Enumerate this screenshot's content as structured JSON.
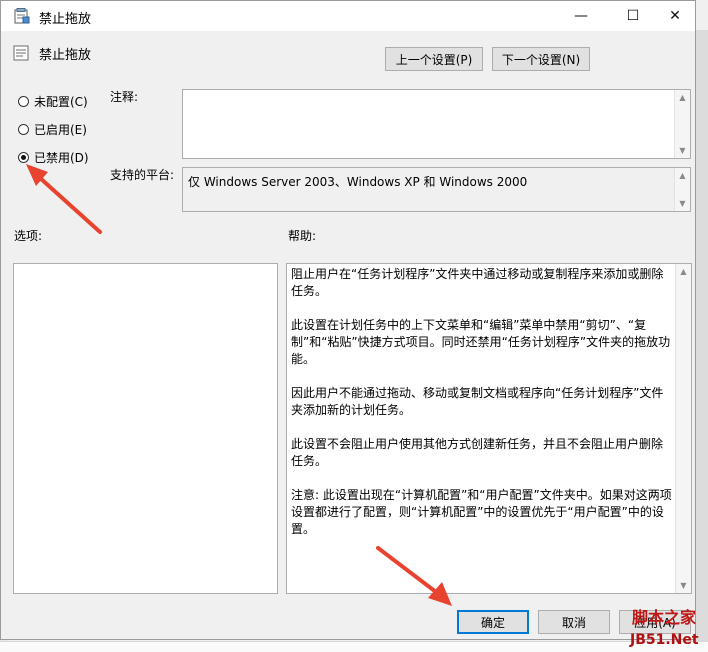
{
  "window": {
    "title": "禁止拖放",
    "controls": {
      "minimize": "—",
      "maximize": "☐",
      "close": "✕"
    }
  },
  "policy": {
    "name": "禁止拖放"
  },
  "nav": {
    "prev_label": "上一个设置(P)",
    "next_label": "下一个设置(N)"
  },
  "state": {
    "options": [
      {
        "label": "未配置(C)",
        "checked": false
      },
      {
        "label": "已启用(E)",
        "checked": false
      },
      {
        "label": "已禁用(D)",
        "checked": true
      }
    ]
  },
  "comment": {
    "label": "注释:",
    "value": ""
  },
  "platform": {
    "label": "支持的平台:",
    "value": "仅 Windows Server 2003、Windows XP 和 Windows 2000"
  },
  "sections": {
    "options_label": "选项:",
    "help_label": "帮助:"
  },
  "help": {
    "paragraphs": [
      "阻止用户在“任务计划程序”文件夹中通过移动或复制程序来添加或删除任务。",
      "此设置在计划任务中的上下文菜单和“编辑”菜单中禁用“剪切”、“复制”和“粘贴”快捷方式项目。同时还禁用“任务计划程序”文件夹的拖放功能。",
      "因此用户不能通过拖动、移动或复制文档或程序向“任务计划程序”文件夹添加新的计划任务。",
      "此设置不会阻止用户使用其他方式创建新任务，并且不会阻止用户删除任务。",
      "注意: 此设置出现在“计算机配置”和“用户配置”文件夹中。如果对这两项设置都进行了配置，则“计算机配置”中的设置优先于“用户配置”中的设置。"
    ]
  },
  "buttons": {
    "ok": "确定",
    "cancel": "取消",
    "apply": "应用(A)"
  },
  "watermark": {
    "line1": "脚本之家",
    "line2": "JB51.Net"
  },
  "colors": {
    "accent": "#0078d7",
    "arrow": "#e8432e"
  }
}
